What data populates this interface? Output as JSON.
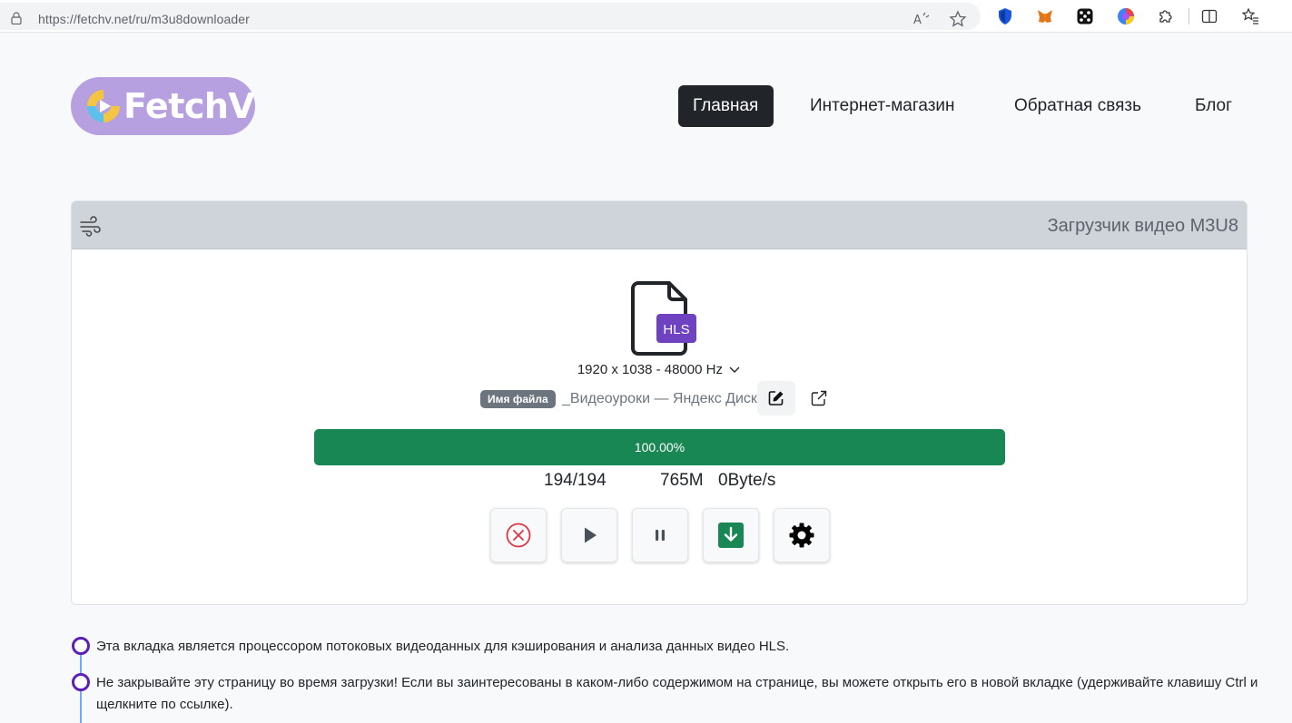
{
  "browser": {
    "url": "https://fetchv.net/ru/m3u8downloader",
    "extensions": [
      "shield-icon",
      "metamask-fox-icon",
      "dice-icon",
      "rainbow-circle-icon",
      "puzzle-icon",
      "split-screen-icon",
      "favorites-icon"
    ]
  },
  "header": {
    "logo_text": "FetchV",
    "nav": [
      {
        "label": "Главная",
        "active": true
      },
      {
        "label": "Интернет-магазин",
        "active": false
      },
      {
        "label": "Обратная связь",
        "active": false
      },
      {
        "label": "Блог",
        "active": false
      }
    ]
  },
  "card": {
    "title": "Загрузчик видео M3U8",
    "file_badge": "HLS",
    "resolution": "1920 x 1038 - 48000 Hz",
    "filename_label": "Имя файла",
    "filename": "_Видеоуроки — Яндекс Диск",
    "progress": {
      "value": 1.0,
      "text": "100.00%"
    },
    "segments": "194/194",
    "size": "765M",
    "speed": "0Byte/s"
  },
  "notes": [
    "Эта вкладка является процессором потоковых видеоданных для кэширования и анализа данных видео HLS.",
    "Не закрывайте эту страницу во время загрузки! Если вы заинтересованы в каком-либо содержимом на странице, вы можете открыть его в новой вкладке (удерживайте клавишу Ctrl и щелкните по ссылке)."
  ],
  "colors": {
    "accent": "#198754",
    "logo_bg": "#b7a0e0",
    "hls_badge": "#6f42c1",
    "timeline_dot": "#5b21b6"
  }
}
